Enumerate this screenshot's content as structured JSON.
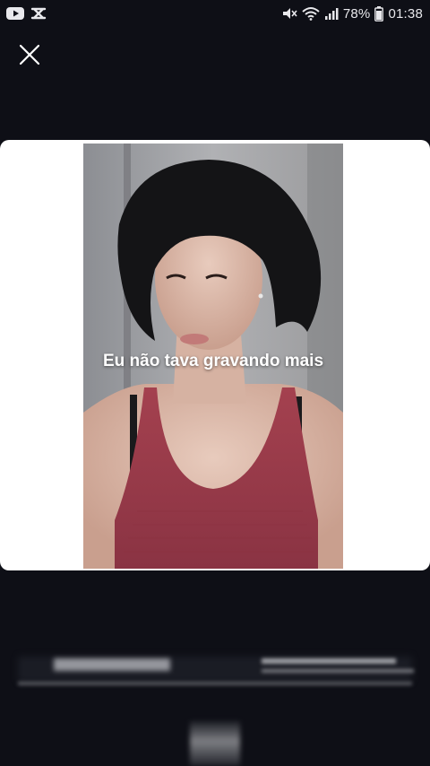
{
  "status_bar": {
    "left_icons": [
      "youtube-icon",
      "capcut-icon"
    ],
    "right_icons": [
      "mute-icon",
      "wifi-icon",
      "signal-icon"
    ],
    "battery_percent": "78%",
    "time": "01:38"
  },
  "close_label": "close",
  "preview": {
    "caption": "Eu não tava gravando mais"
  },
  "colors": {
    "background": "#0e0f16",
    "card": "#ffffff",
    "top_color": "#9b3a4c"
  }
}
